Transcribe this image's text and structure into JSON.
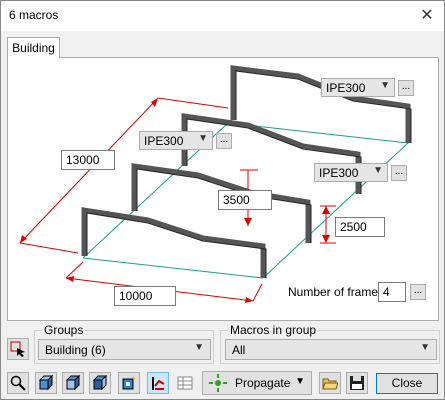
{
  "window": {
    "title": "6 macros",
    "close_glyph": "✕"
  },
  "tabs": [
    {
      "label": "Building"
    }
  ],
  "diagram": {
    "profile_rear": "IPE300",
    "profile_middle": "IPE300",
    "profile_right": "IPE300",
    "length": "13000",
    "width": "10000",
    "ridge_height": "3500",
    "eave_height": "2500",
    "dots": "...",
    "num_frames_label": "Number of frames:",
    "num_frames": "4"
  },
  "groups": {
    "label": "Groups",
    "selected": "Building (6)"
  },
  "macros_in_group": {
    "label": "Macros in group",
    "selected": "All"
  },
  "toolbar": {
    "propagate_label": "Propagate",
    "close_label": "Close"
  },
  "colors": {
    "dimension": "#e00000",
    "outline": "#1aa08a",
    "member": "#555555",
    "focus": "#0078d7"
  }
}
